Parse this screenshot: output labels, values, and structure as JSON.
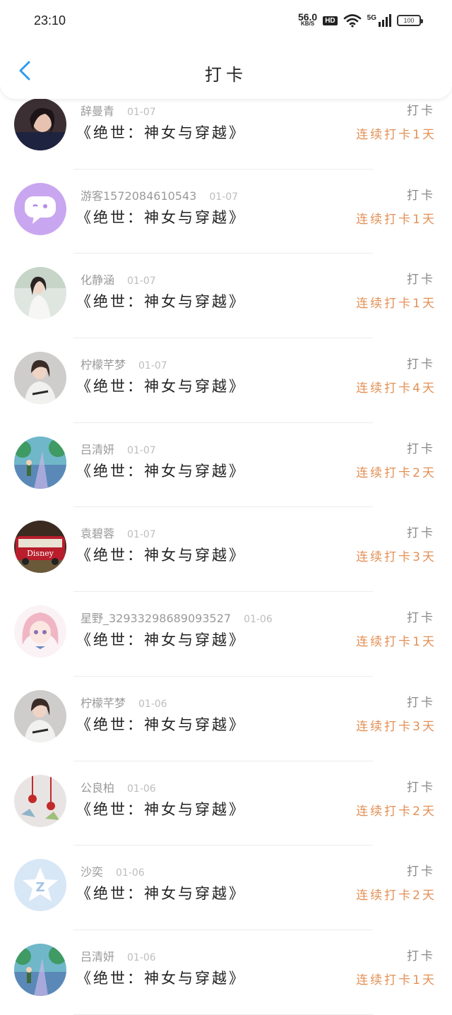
{
  "status_bar": {
    "time": "23:10",
    "net_speed": "56.0",
    "net_unit": "KB/S",
    "hd_label": "HD",
    "signal_label": "5G",
    "battery": "100"
  },
  "header": {
    "title": "打卡",
    "back_icon": "chevron-left-icon",
    "accent_color": "#2e9bf0"
  },
  "colors": {
    "streak": "#e39056"
  },
  "entries": [
    {
      "name": "辞曼青",
      "date": "01-07",
      "book": "《绝世：神女与穿越》",
      "action": "打卡",
      "streak": "连续打卡1天",
      "avatar": "photo-girl-dark"
    },
    {
      "name": "游客1572084610543",
      "date": "01-07",
      "book": "《绝世：神女与穿越》",
      "action": "打卡",
      "streak": "连续打卡1天",
      "avatar": "chat-bubble-lavender"
    },
    {
      "name": "化静涵",
      "date": "01-07",
      "book": "《绝世：神女与穿越》",
      "action": "打卡",
      "streak": "连续打卡1天",
      "avatar": "photo-girl-light"
    },
    {
      "name": "柠檬芊梦",
      "date": "01-07",
      "book": "《绝世：神女与穿越》",
      "action": "打卡",
      "streak": "连续打卡4天",
      "avatar": "photo-girl-gray"
    },
    {
      "name": "吕清妍",
      "date": "01-07",
      "book": "《绝世：神女与穿越》",
      "action": "打卡",
      "streak": "连续打卡2天",
      "avatar": "anime-scene"
    },
    {
      "name": "袁碧蓉",
      "date": "01-07",
      "book": "《绝世：神女与穿越》",
      "action": "打卡",
      "streak": "连续打卡3天",
      "avatar": "bus"
    },
    {
      "name": "星野_32933298689093527",
      "date": "01-06",
      "book": "《绝世：神女与穿越》",
      "action": "打卡",
      "streak": "连续打卡1天",
      "avatar": "anime-girl-pink"
    },
    {
      "name": "柠檬芊梦",
      "date": "01-06",
      "book": "《绝世：神女与穿越》",
      "action": "打卡",
      "streak": "连续打卡3天",
      "avatar": "photo-girl-gray"
    },
    {
      "name": "公良柏",
      "date": "01-06",
      "book": "《绝世：神女与穿越》",
      "action": "打卡",
      "streak": "连续打卡2天",
      "avatar": "chinese-knots"
    },
    {
      "name": "沙奕",
      "date": "01-06",
      "book": "《绝世：神女与穿越》",
      "action": "打卡",
      "streak": "连续打卡2天",
      "avatar": "star-logo"
    },
    {
      "name": "吕清妍",
      "date": "01-06",
      "book": "《绝世：神女与穿越》",
      "action": "打卡",
      "streak": "连续打卡1天",
      "avatar": "anime-scene"
    }
  ]
}
